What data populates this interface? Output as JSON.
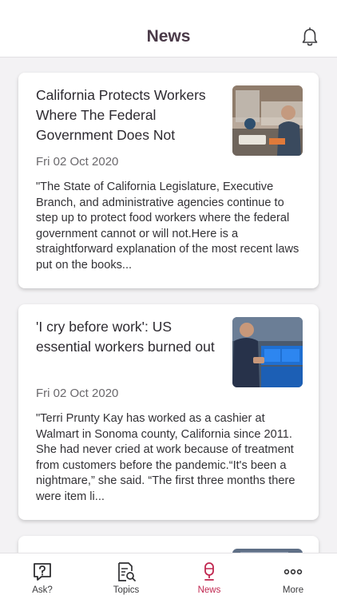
{
  "header": {
    "title": "News"
  },
  "articles": [
    {
      "title": "California Protects Workers Where The Federal Government Does Not",
      "date": "Fri 02 Oct 2020",
      "excerpt": "\"The State of California Legislature, Executive Branch, and administrative agencies continue to step up to protect food workers where the federal government cannot or will not.Here is a straightforward explanation of the most recent laws put on the books..."
    },
    {
      "title": "'I cry before work': US essential workers burned out",
      "date": "Fri 02 Oct 2020",
      "excerpt": "\"Terri Prunty Kay has worked as a cashier at Walmart in Sonoma county, California since 2011. She had never cried at work because of treatment from customers before the pandemic.“It's been a nightmare,” she said. “The first three months there were item li..."
    }
  ],
  "tabs": [
    {
      "label": "Ask?",
      "icon": "question-icon"
    },
    {
      "label": "Topics",
      "icon": "topics-icon"
    },
    {
      "label": "News",
      "icon": "news-mic-icon",
      "active": true
    },
    {
      "label": "More",
      "icon": "more-icon"
    }
  ],
  "colors": {
    "accent": "#c0264f",
    "title": "#4a3a48",
    "background": "#f3f2f4"
  }
}
